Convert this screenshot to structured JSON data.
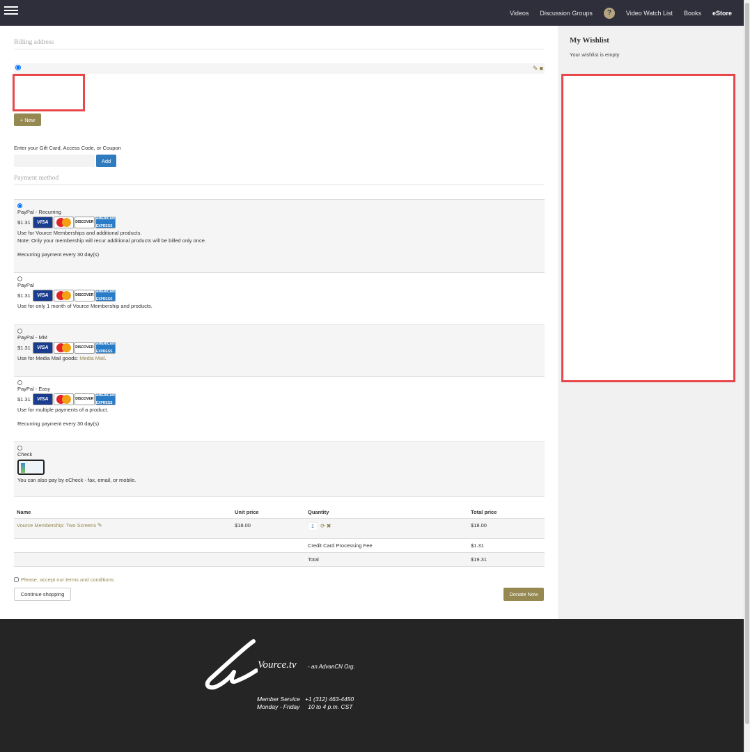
{
  "nav": {
    "links": [
      "Videos",
      "Discussion Groups",
      "Video Watch List",
      "Books",
      "eStore"
    ],
    "help": "?"
  },
  "billing": {
    "title": "Billing address",
    "new_label": "New"
  },
  "gift": {
    "label": "Enter your Gift Card, Access Code, or Coupon",
    "add_label": "Add"
  },
  "payment": {
    "title": "Payment method",
    "methods": [
      {
        "name": "PayPal - Recurring",
        "price": "$1.31",
        "desc1": "Use for Vource Memberships and additional products.",
        "desc2": "Note: Only your membership will recur additional products will be billed only once.",
        "desc3": "Recurring payment every 30 day(s)"
      },
      {
        "name": "PayPal",
        "price": "$1.31",
        "desc1": "Use for only 1 month of Vource Membership and products."
      },
      {
        "name": "PayPal - MM",
        "price": "$1.31",
        "desc1": "Use for Media Mail goods: ",
        "link": "Media Mail"
      },
      {
        "name": "PayPal - Easy",
        "price": "$1.31",
        "desc1": "Use for multiple payments of a product.",
        "desc3": "Recurring payment every 30 day(s)"
      },
      {
        "name": "Check",
        "desc1": "You can also pay by eCheck - fax, email, or mobile."
      }
    ],
    "cards": {
      "visa": "VISA",
      "discover": "DISCOVER",
      "amex": "AMERICAN EXPRESS"
    }
  },
  "order": {
    "headers": [
      "Name",
      "Unit price",
      "Quantity",
      "Total price"
    ],
    "item": {
      "name": "Vource Membership: Two Screens",
      "unit": "$18.00",
      "qty": "1",
      "total": "$18.00"
    },
    "fee": {
      "label": "Credit Card Processing Fee",
      "value": "$1.31"
    },
    "total": {
      "label": "Total",
      "value": "$19.31"
    }
  },
  "terms": "Please, accept our terms and conditions",
  "buttons": {
    "continue": "Continue shopping",
    "donate": "Donate Now"
  },
  "wishlist": {
    "title": "My Wishlist",
    "empty": "Your wishlist is empty"
  },
  "footer": {
    "brand": "Vource.tv",
    "brand_sub": "- an AdvanCN Org.",
    "line1": "Member Service   +1 (312) 463-4450",
    "line2": "Monday - Friday     10 to 4 p.m. CST"
  }
}
